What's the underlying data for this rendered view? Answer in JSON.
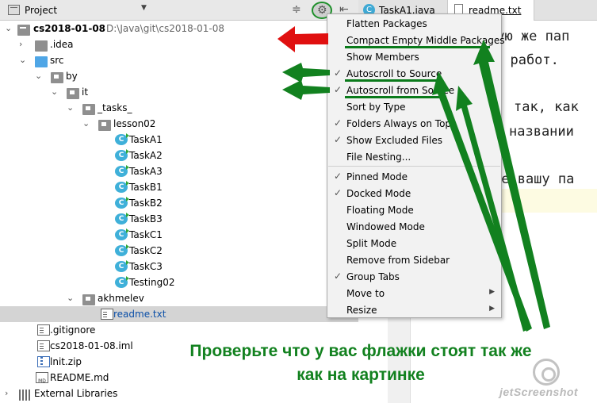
{
  "project_panel": {
    "title": "Project"
  },
  "editor": {
    "tabs": [
      {
        "label": "TaskA1.java",
        "icon": "java-class-icon"
      },
      {
        "label": "readme.txt",
        "icon": "text-file-icon",
        "active": true
      }
    ],
    "lines": [
      "кую же пап",
      "х работ.",
      "так, как",
      "названии",
      "те вашу па"
    ]
  },
  "tree": {
    "root": {
      "label": "cs2018-01-08",
      "path": "D:\\Java\\git\\cs2018-01-08"
    },
    "items": [
      {
        "label": ".idea"
      },
      {
        "label": "src"
      },
      {
        "label": "by"
      },
      {
        "label": "it"
      },
      {
        "label": "_tasks_"
      },
      {
        "label": "lesson02"
      },
      {
        "label": "TaskA1"
      },
      {
        "label": "TaskA2"
      },
      {
        "label": "TaskA3"
      },
      {
        "label": "TaskB1"
      },
      {
        "label": "TaskB2"
      },
      {
        "label": "TaskB3"
      },
      {
        "label": "TaskC1"
      },
      {
        "label": "TaskC2"
      },
      {
        "label": "TaskC3"
      },
      {
        "label": "Testing02"
      },
      {
        "label": "akhmelev"
      },
      {
        "label": "readme.txt"
      },
      {
        "label": ".gitignore"
      },
      {
        "label": "cs2018-01-08.iml"
      },
      {
        "label": "lnit.zip"
      },
      {
        "label": "README.md"
      },
      {
        "label": "External Libraries"
      }
    ]
  },
  "menu": {
    "items": [
      {
        "label": "Flatten Packages",
        "checked": false
      },
      {
        "label": "Compact Empty Middle Packages",
        "checked": false
      },
      {
        "label": "Show Members",
        "checked": false
      },
      {
        "label": "Autoscroll to Source",
        "checked": true
      },
      {
        "label": "Autoscroll from Source",
        "checked": true
      },
      {
        "label": "Sort by Type",
        "checked": false
      },
      {
        "label": "Folders Always on Top",
        "checked": true
      },
      {
        "label": "Show Excluded Files",
        "checked": true
      },
      {
        "label": "File Nesting...",
        "checked": false
      },
      {
        "label": "Pinned Mode",
        "checked": true
      },
      {
        "label": "Docked Mode",
        "checked": true
      },
      {
        "label": "Floating Mode",
        "checked": false
      },
      {
        "label": "Windowed Mode",
        "checked": false
      },
      {
        "label": "Split Mode",
        "checked": false
      },
      {
        "label": "Remove from Sidebar",
        "checked": false
      },
      {
        "label": "Group Tabs",
        "checked": true
      },
      {
        "label": "Move to",
        "checked": false,
        "submenu": true
      },
      {
        "label": "Resize",
        "checked": false,
        "submenu": true
      }
    ]
  },
  "annotation": {
    "line1": "Проверьте что у вас флажки стоят так же",
    "line2": "как на картинке",
    "colors": {
      "green": "#12811f",
      "red": "#e01010"
    }
  },
  "watermark": "jetScreenshot"
}
